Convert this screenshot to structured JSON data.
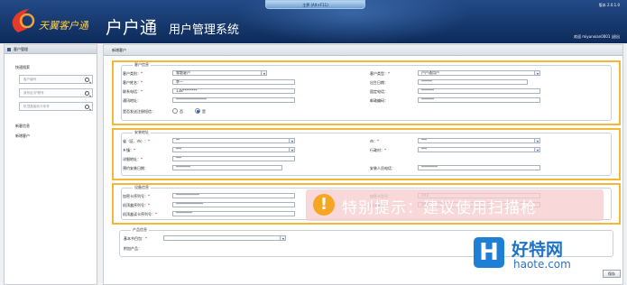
{
  "window": {
    "tab_title": "主界 (Alt+F11)"
  },
  "header": {
    "brand": "天翼客户通",
    "title": "户户通",
    "subtitle": "用户管理系统",
    "version": "版本 2.0.1.0",
    "welcome": "欢迎 miyunxian0001 |",
    "logout": "退出"
  },
  "sidebar": {
    "title": "客户管理",
    "quick_search": "快速搜索",
    "inputs": [
      {
        "placeholder": "客户编号"
      },
      {
        "placeholder": "身份证/护照号"
      },
      {
        "placeholder": "机顶盒接收卡序号"
      }
    ],
    "links": [
      "新客信息",
      "新增客户"
    ]
  },
  "main": {
    "tab": "新增客户",
    "customer": {
      "legend": "客户信息",
      "type_label": "客户类别：",
      "type_value": "零散客户",
      "name_label": "客户姓名：",
      "name_value": "李一",
      "phone_label": "联系电话：",
      "phone_value": "138********",
      "address_label": "通讯地址：",
      "address_value": "*****************",
      "reg_label": "是否发送注册短信：",
      "radio_no": "否",
      "radio_yes": "是",
      "ctype_label": "客户类型：",
      "ctype_value": "户户通用户",
      "birth_label": "出生日期：",
      "birth_value": "******",
      "fixed_label": "固定电话：",
      "fixed_value": "*******",
      "zip_label": "邮政编码：",
      "zip_value": "*******"
    },
    "install": {
      "legend": "安装地址",
      "prov_label": "省（区、市）：",
      "prov_value": "**",
      "county_label": "乡镇：",
      "county_value": "***",
      "detail_label": "详细地址：",
      "detail_value": "***",
      "date_label": "预约安装日期：",
      "date_value": "********",
      "city_label": "市：",
      "city_value": "***",
      "village_label": "行政村：",
      "village_value": "***",
      "staff_label": "安装人员电话：",
      "staff_value": "*********"
    },
    "device": {
      "legend": "设备信息",
      "card_label": "加密卡序列号：",
      "card_value": "*************",
      "stb_label": "机顶盒序列号：",
      "stb_value": "***************",
      "ant_label": "机顶盒读卡序列号：",
      "ant_value": "*********",
      "card2_label": "加密卡型号：",
      "card2_value": "XXX",
      "stb2_label": "机顶盒型号：",
      "stb2_value": "XXX"
    },
    "product": {
      "legend": "产品信息",
      "pkg_label": "基本节目包：",
      "extra_label": "附加产品："
    },
    "toast": "特别提示：建议使用扫描枪",
    "submit": "保存"
  },
  "watermark": {
    "logo": "H",
    "name": "好特网",
    "url": "haote.com"
  }
}
